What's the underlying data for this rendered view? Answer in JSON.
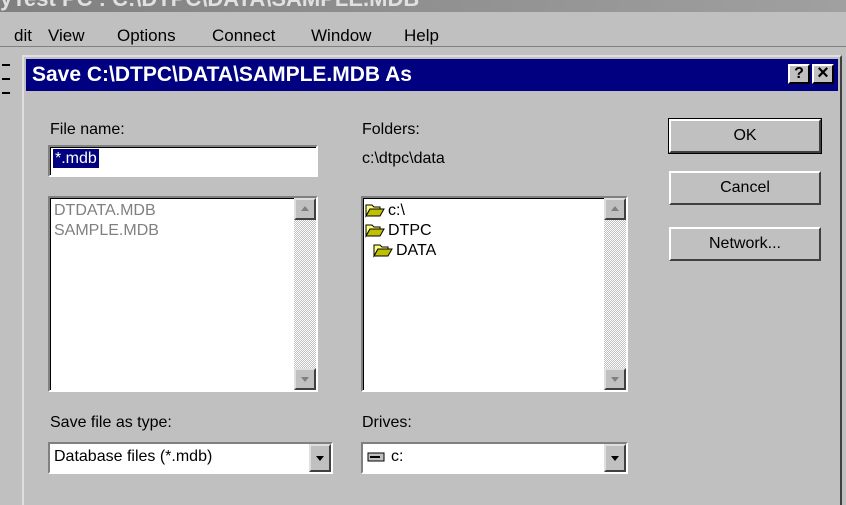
{
  "app": {
    "title": "yTest PC : C:\\DTPC\\DATA\\SAMPLE.MDB",
    "menu": [
      "dit",
      "View",
      "Options",
      "Connect",
      "Window",
      "Help"
    ]
  },
  "dialog": {
    "title": "Save C:\\DTPC\\DATA\\SAMPLE.MDB As",
    "help_glyph": "?",
    "close_glyph": "×",
    "file_name": {
      "label": "File name:",
      "value": "*.mdb",
      "files": [
        "DTDATA.MDB",
        "SAMPLE.MDB"
      ]
    },
    "folders": {
      "label": "Folders:",
      "current_path": "c:\\dtpc\\data",
      "tree": [
        {
          "name": "c:\\",
          "icon": "open-folder-icon"
        },
        {
          "name": "DTPC",
          "icon": "open-folder-icon"
        },
        {
          "name": "DATA",
          "icon": "open-folder-icon"
        }
      ]
    },
    "save_type": {
      "label": "Save file as type:",
      "selected": "Database files (*.mdb)"
    },
    "drives": {
      "label": "Drives:",
      "selected": "c:",
      "icon": "drive-icon"
    },
    "buttons": {
      "ok": "OK",
      "cancel": "Cancel",
      "network": "Network..."
    }
  }
}
